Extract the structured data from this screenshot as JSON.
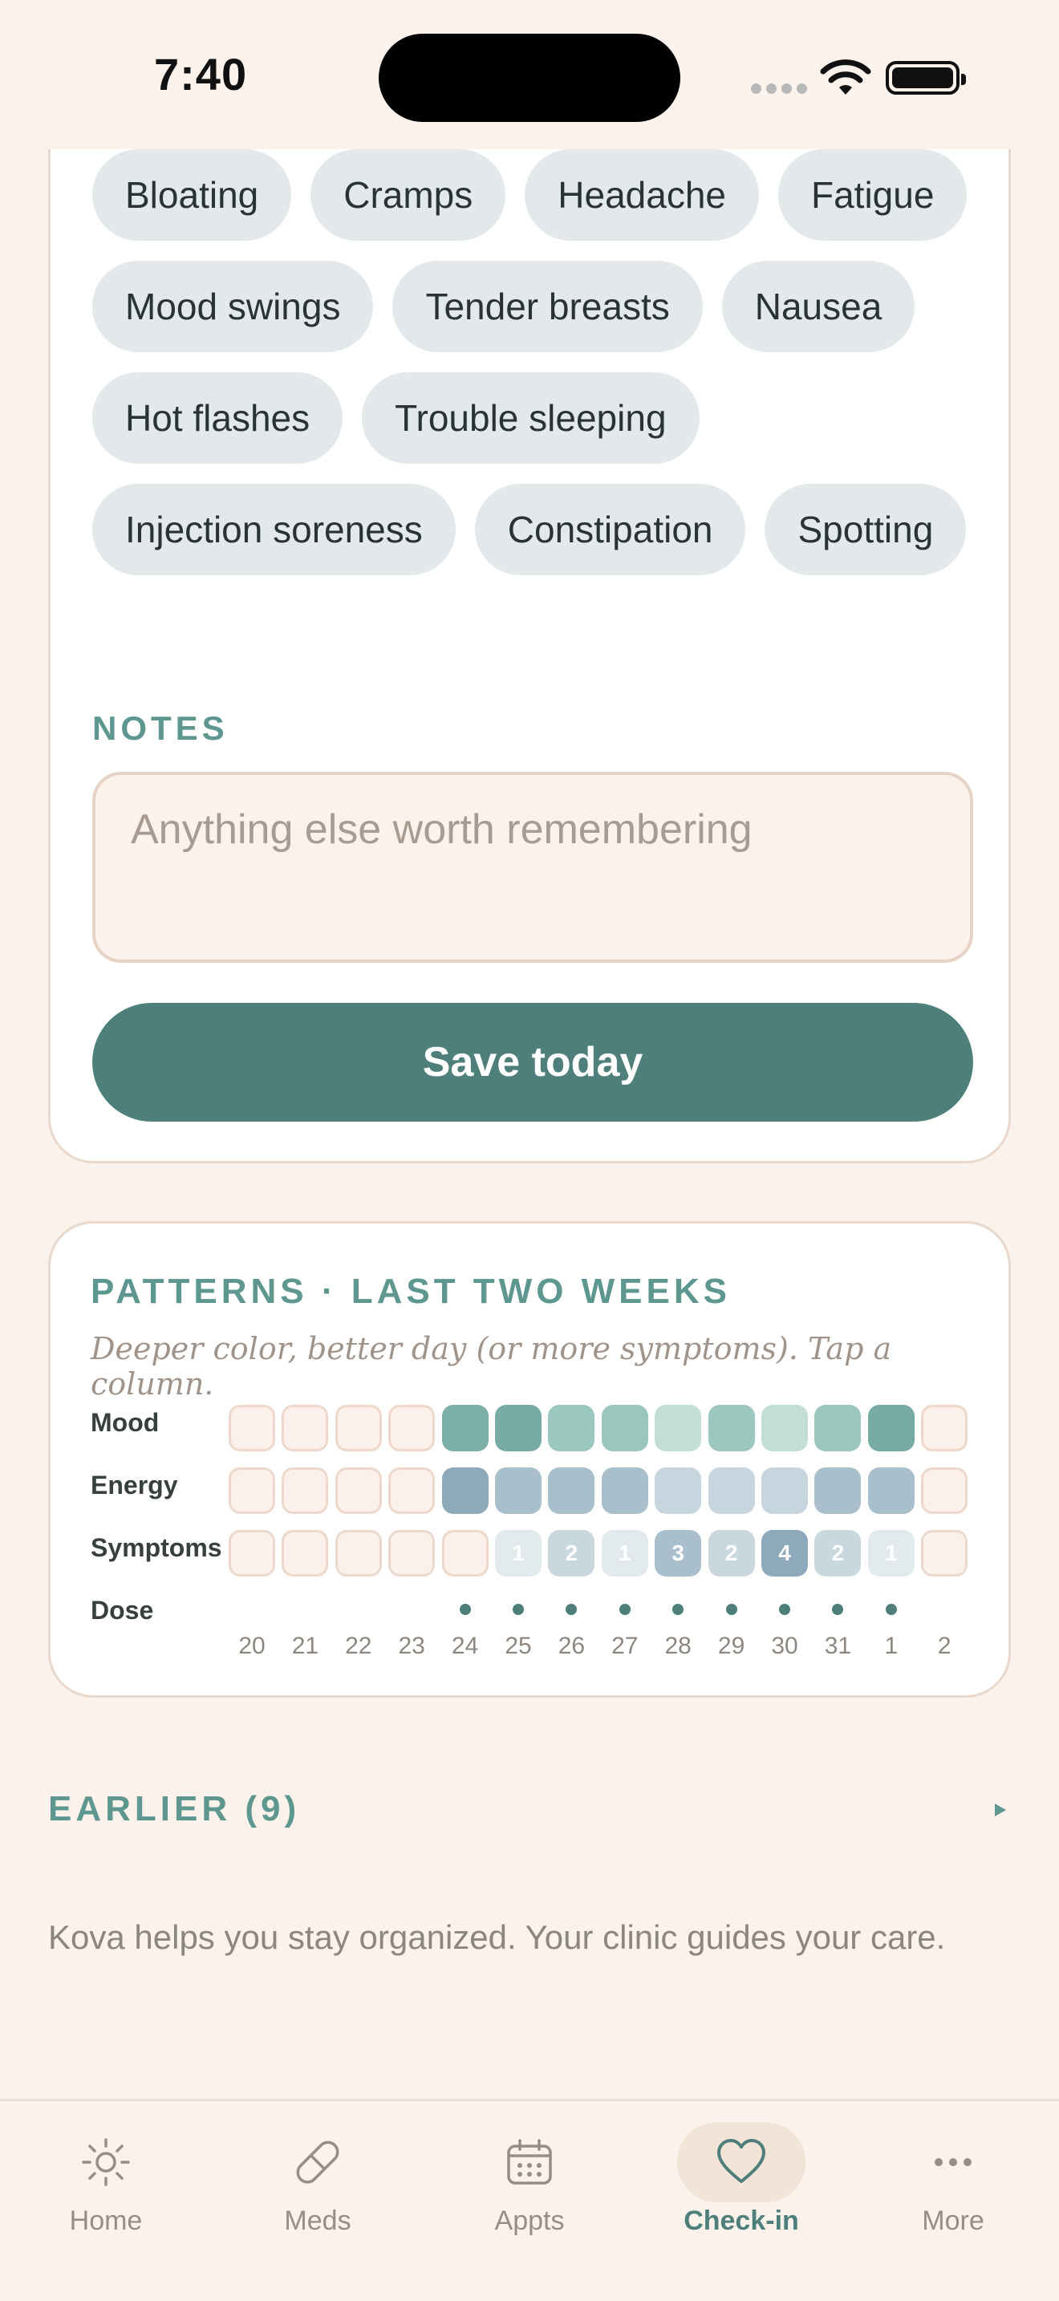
{
  "status_bar": {
    "time": "7:40"
  },
  "symptoms": {
    "chips": [
      "Bloating",
      "Cramps",
      "Headache",
      "Fatigue",
      "Mood swings",
      "Tender breasts",
      "Nausea",
      "Hot flashes",
      "Trouble sleeping",
      "Injection soreness",
      "Constipation",
      "Spotting"
    ]
  },
  "notes": {
    "label": "NOTES",
    "placeholder": "Anything else worth remembering"
  },
  "save_button": {
    "label": "Save today"
  },
  "patterns": {
    "title": "PATTERNS · LAST TWO WEEKS",
    "subtitle": "Deeper color, better day (or more symptoms). Tap a column.",
    "row_labels": {
      "mood": "Mood",
      "energy": "Energy",
      "symptoms": "Symptoms",
      "dose": "Dose"
    },
    "days": [
      "20",
      "21",
      "22",
      "23",
      "24",
      "25",
      "26",
      "27",
      "28",
      "29",
      "30",
      "31",
      "1",
      "2"
    ],
    "mood_colors": [
      null,
      null,
      null,
      null,
      "#7BAEA5",
      "#78ABA3",
      "#9CC7BF",
      "#9BC6BE",
      "#C2DED7",
      "#9DC7BF",
      "#C2DED7",
      "#9BC6BE",
      "#78ABA3",
      null
    ],
    "energy_colors": [
      null,
      null,
      null,
      null,
      "#8EA9B9",
      "#A9BFCC",
      "#A9BFCC",
      "#A9BFCC",
      "#C7D6DE",
      "#C7D6DE",
      "#C7D6DE",
      "#A9BFCC",
      "#A9BFCC",
      null
    ],
    "symptom_counts": [
      null,
      null,
      null,
      null,
      null,
      "1",
      "2",
      "1",
      "3",
      "2",
      "4",
      "2",
      "1",
      null
    ],
    "symptom_colors": [
      null,
      null,
      null,
      null,
      null,
      "#E2EAEE",
      "#C9D7DE",
      "#E2EAEE",
      "#A9BFCC",
      "#C9D7DE",
      "#8EA9B9",
      "#C9D7DE",
      "#E2EAEE",
      null
    ],
    "dose_taken": [
      false,
      false,
      false,
      false,
      true,
      true,
      true,
      true,
      true,
      true,
      true,
      true,
      true,
      false
    ]
  },
  "earlier": {
    "label": "EARLIER (9)"
  },
  "disclaimer": "Kova helps you stay organized. Your clinic guides your care.",
  "tabbar": {
    "tabs": [
      {
        "id": "home",
        "label": "Home",
        "icon": "sun-icon",
        "active": false
      },
      {
        "id": "meds",
        "label": "Meds",
        "icon": "pill-icon",
        "active": false
      },
      {
        "id": "appts",
        "label": "Appts",
        "icon": "calendar-icon",
        "active": false
      },
      {
        "id": "checkin",
        "label": "Check-in",
        "icon": "heart-icon",
        "active": true
      },
      {
        "id": "more",
        "label": "More",
        "icon": "more-dots-icon",
        "active": false
      }
    ]
  },
  "colors": {
    "accent": "#4E7F7A",
    "background": "#FAF2EB",
    "chip_bg": "#E3E9EB"
  }
}
